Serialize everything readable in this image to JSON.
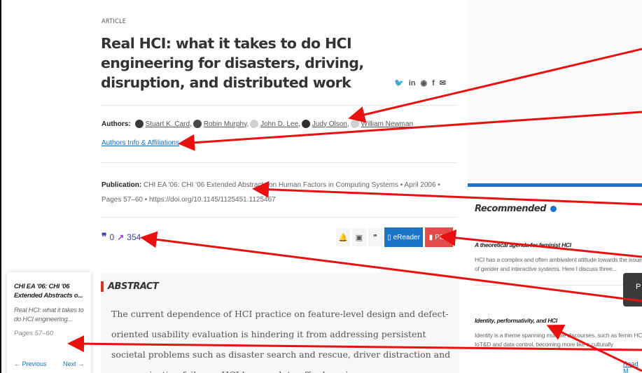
{
  "article": {
    "kicker": "ARTICLE",
    "title": "Real HCI: what it takes to do HCI engineering for disasters, driving, disruption, and distributed work",
    "share_icons": [
      "twitter-icon",
      "linkedin-icon",
      "reddit-icon",
      "facebook-icon",
      "email-icon"
    ],
    "authors_label": "Authors:",
    "authors": [
      {
        "name": "Stuart K. Card,",
        "photo": true
      },
      {
        "name": "Robin Murphy,",
        "photo": true
      },
      {
        "name": "John D. Lee,",
        "photo": false
      },
      {
        "name": "Judy Olson,",
        "photo": true
      },
      {
        "name": "William Newman",
        "photo": false
      }
    ],
    "affiliations_link": "Authors Info & Affiliations",
    "publication_label": "Publication:",
    "publication_text": "CHI EA '06: CHI '06 Extended Abstracts on Human Factors in Computing Systems • April 2006 • Pages 57–60 • https://doi.org/10.1145/1125451.1125467",
    "citations": "0",
    "downloads": "354",
    "toolbar": {
      "ereader_label": "eReader",
      "pdf_label": "PDF"
    },
    "abstract_heading": "ABSTRACT",
    "abstract_text": "The current dependence of HCI practice on feature-level design and defect-oriented usability evaluation is hindering it from addressing persistent societal problems such as disaster search and rescue, driver distraction and communication failures. HCI has much to offer here in"
  },
  "side_nav": {
    "venue": "CHI EA '06: CHI '06 Extended Abstracts o...",
    "article": "Real HCI: what it takes to do HCI engineering...",
    "pages": "Pages 57–60",
    "previous": "← Previous",
    "next": "Next →"
  },
  "recommended": {
    "heading": "Recommended",
    "items": [
      {
        "title": "A theoretical agenda for feminist HCI",
        "text": "HCI has a complex and often ambivalent attitude towards the issue of gender and interactive systems. Here I discuss three..."
      },
      {
        "title": "Identity, performativity, and HCI",
        "text": "Identity is a theme spanning multiple discourses, such as femin HCI, IoT&D and data control, becoming more like a culturally"
      }
    ],
    "popup_text": "P",
    "read_more": "Read M"
  },
  "colors": {
    "accent_blue": "#1a74c9",
    "pdf_red": "#e54b4b",
    "arrow_red": "#e8110f"
  }
}
